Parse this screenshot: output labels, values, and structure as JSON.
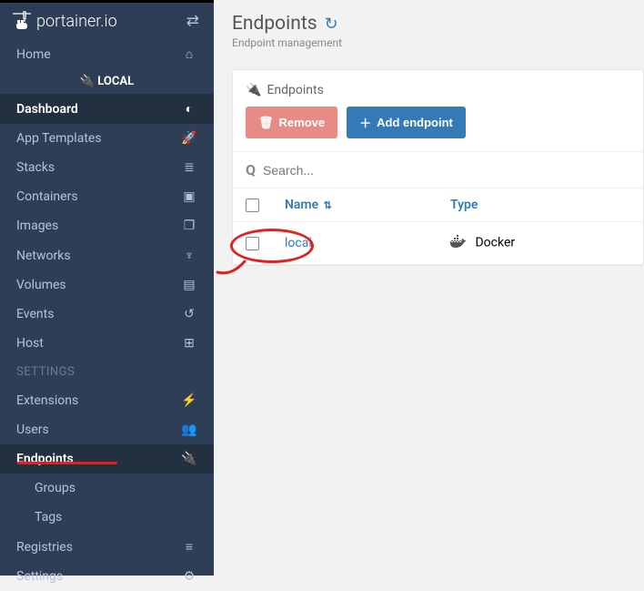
{
  "brand": "portainer.io",
  "env_label": "LOCAL",
  "nav": {
    "home": "Home",
    "dashboard": "Dashboard",
    "app_templates": "App Templates",
    "stacks": "Stacks",
    "containers": "Containers",
    "images": "Images",
    "networks": "Networks",
    "volumes": "Volumes",
    "events": "Events",
    "host": "Host"
  },
  "section_settings": "SETTINGS",
  "settings_nav": {
    "extensions": "Extensions",
    "users": "Users",
    "endpoints": "Endpoints",
    "groups": "Groups",
    "tags": "Tags",
    "registries": "Registries",
    "settings": "Settings"
  },
  "page": {
    "title": "Endpoints",
    "subtitle": "Endpoint management"
  },
  "panel": {
    "header": "Endpoints",
    "remove": "Remove",
    "add": "Add endpoint",
    "search_placeholder": "Search..."
  },
  "table": {
    "col_name": "Name",
    "col_type": "Type",
    "rows": [
      {
        "name": "local",
        "type": "Docker"
      }
    ]
  }
}
